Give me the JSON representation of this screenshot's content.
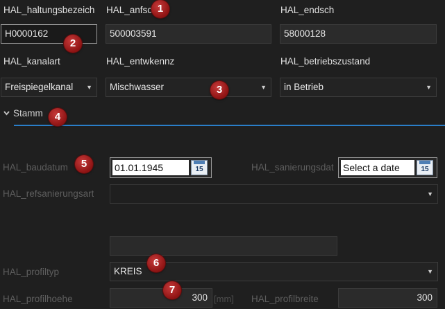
{
  "row1": {
    "labels": [
      "HAL_haltungsbezeich",
      "HAL_anfsc",
      "HAL_endsch"
    ],
    "values": [
      "H0000162",
      "500003591",
      "58000128"
    ]
  },
  "row2": {
    "labels": [
      "HAL_kanalart",
      "HAL_entwkennz",
      "HAL_betriebszustand"
    ],
    "values": [
      "Freispiegelkanal",
      "Mischwasser",
      "in Betrieb"
    ]
  },
  "section": {
    "title": "Stamm",
    "chevron": "chevron-down-icon",
    "accent": "#2a7ec8"
  },
  "stamm": {
    "baudatum_label": "HAL_baudatum",
    "baudatum_value": "01.01.1945",
    "sanierungsdat_label": "HAL_sanierungsdat",
    "sanierungsdat_placeholder": "Select a date",
    "calendar_day": "15",
    "refsanierungsart_label": "HAL_refsanierungsart",
    "refsanierungsart_value": "",
    "profiltyp_label": "HAL_profiltyp",
    "profiltyp_value": "KREIS",
    "profilhoehe_label": "HAL_profilhoehe",
    "profilhoehe_value": "300",
    "profilhoehe_unit": "[mm]",
    "profilbreite_label": "HAL_profilbreite",
    "profilbreite_value": "300"
  },
  "badges": [
    "1",
    "2",
    "3",
    "4",
    "5",
    "6",
    "7"
  ],
  "icons": {
    "dropdown": "chevron-down-icon",
    "calendar": "calendar-icon"
  },
  "colors": {
    "background": "#1f1f1f",
    "badge": "#a31b1b",
    "accent_line": "#2a7ec8"
  }
}
